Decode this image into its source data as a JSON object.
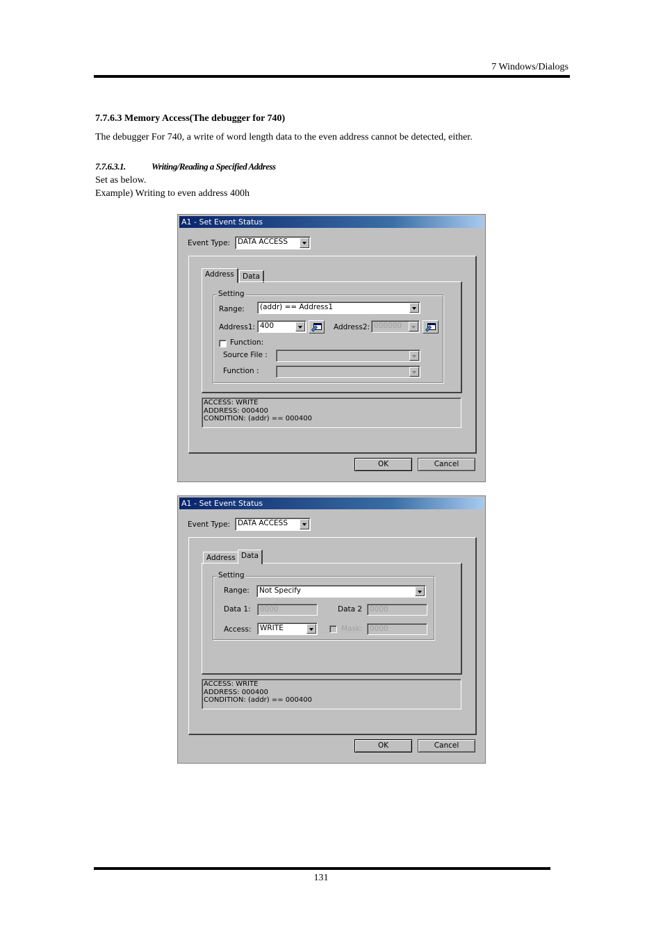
{
  "page": {
    "running_header": "7  Windows/Dialogs",
    "section_heading": "7.7.6.3 Memory Access(The debugger for 740)",
    "intro_paragraph": "The debugger For 740, a write of word length data to the even address cannot be detected, either.",
    "subsection_number": "7.7.6.3.1.",
    "subsection_title": "Writing/Reading a Specified Address",
    "line_set_as_below": "Set as below.",
    "line_example": "Example) Writing to even address 400h",
    "page_number": "131"
  },
  "dialog1": {
    "title": "A1 - Set Event Status",
    "event_type_label": "Event Type:",
    "event_type_value": "DATA ACCESS",
    "tabs": [
      {
        "label": "Address",
        "active": true
      },
      {
        "label": "Data",
        "active": false
      }
    ],
    "setting_legend": "Setting",
    "range_label": "Range:",
    "range_value": "(addr) == Address1",
    "address1_label": "Address1:",
    "address1_value": "400",
    "address2_label": "Address2:",
    "address2_value": "000000",
    "function_checkbox_label": "Function:",
    "function_checked": false,
    "source_file_label": "Source File :",
    "source_file_value": "",
    "function_label": "Function :",
    "function_value": "",
    "info_lines": [
      "ACCESS: WRITE",
      "ADDRESS: 000400",
      "CONDITION: (addr) == 000400"
    ],
    "ok_label": "OK",
    "cancel_label": "Cancel"
  },
  "dialog2": {
    "title": "A1 - Set Event Status",
    "event_type_label": "Event Type:",
    "event_type_value": "DATA ACCESS",
    "tabs": [
      {
        "label": "Address",
        "active": false
      },
      {
        "label": "Data",
        "active": true
      }
    ],
    "setting_legend": "Setting",
    "range_label": "Range:",
    "range_value": "Not Specify",
    "data1_label": "Data 1:",
    "data1_value": "0000",
    "data2_label": "Data 2",
    "data2_value": "0000",
    "access_label": "Access:",
    "access_value": "WRITE",
    "mask_label": "Mask:",
    "mask_checked": false,
    "mask_value": "0000",
    "info_lines": [
      "ACCESS: WRITE",
      "ADDRESS: 000400",
      "CONDITION: (addr) == 000400"
    ],
    "ok_label": "OK",
    "cancel_label": "Cancel"
  }
}
